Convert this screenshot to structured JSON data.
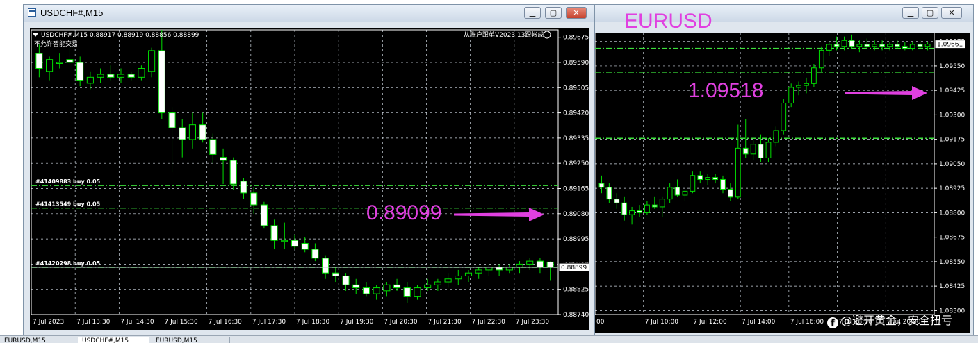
{
  "colors": {
    "bg": "#000000",
    "grid": "#cfd8e2",
    "bull": "#ffffff",
    "bear": "#ffffff",
    "wick": "#00e000",
    "level": "#3be03b",
    "accent": "#e040e0"
  },
  "back_window": {
    "title": "EURUSD",
    "axis_prices": [
      "1.09675",
      "1.09550",
      "1.09425",
      "1.09300",
      "1.09175",
      "1.09050",
      "1.08925",
      "1.08800",
      "1.08675",
      "1.08550",
      "1.08425",
      "1.08300"
    ],
    "time_labels": [
      "00",
      "7 Jul 10:00",
      "7 Jul 12:00",
      "7 Jul 14:00",
      "7 Jul 16:00",
      "7 Jul 18:00",
      "7 Jul 20:00"
    ],
    "current_price": "1.09661",
    "annotation": "1.09518",
    "arrow_icon": "right-arrow-icon"
  },
  "front_window": {
    "title": "USDCHF#,M15",
    "header_line": "USDCHF#,M15  0.88917 0.88919 0.88856 0.88899",
    "no_trade_text": "不允许智能交易",
    "signal_text": "从账户跟单V2023.13跟帐成",
    "axis_prices": [
      "0.89675",
      "0.89590",
      "0.89505",
      "0.89420",
      "0.89335",
      "0.89250",
      "0.89165",
      "0.89080",
      "0.88995",
      "0.88910",
      "0.88825",
      "0.88740"
    ],
    "time_labels": [
      "7 Jul 2023",
      "7 Jul 13:30",
      "7 Jul 14:30",
      "7 Jul 15:30",
      "7 Jul 16:30",
      "7 Jul 17:30",
      "7 Jul 18:30",
      "7 Jul 19:30",
      "7 Jul 20:30",
      "7 Jul 21:30",
      "7 Jul 22:30",
      "7 Jul 23:30"
    ],
    "current_price": "0.88899",
    "orders": [
      {
        "label": "#41409883 buy 0.05",
        "price": 0.89175
      },
      {
        "label": "#41413549 buy 0.05",
        "price": 0.89099
      },
      {
        "label": "#41420298 buy 0.05",
        "price": 0.88899
      }
    ],
    "annotation": "0.89099",
    "arrow_icon": "right-arrow-icon"
  },
  "chart_data": [
    {
      "type": "candlestick",
      "title": "USDCHF#,M15",
      "ylim": [
        0.8874,
        0.897
      ],
      "candles": [
        [
          0.8962,
          0.8965,
          0.8954,
          0.8957
        ],
        [
          0.8956,
          0.8961,
          0.8953,
          0.896
        ],
        [
          0.8959,
          0.8962,
          0.8957,
          0.8959
        ],
        [
          0.896,
          0.8964,
          0.8958,
          0.8959
        ],
        [
          0.8959,
          0.8961,
          0.8951,
          0.8953
        ],
        [
          0.8952,
          0.8956,
          0.895,
          0.8954
        ],
        [
          0.8954,
          0.8957,
          0.8952,
          0.8955
        ],
        [
          0.8955,
          0.8958,
          0.8953,
          0.8954
        ],
        [
          0.8954,
          0.8957,
          0.8952,
          0.8955
        ],
        [
          0.8955,
          0.8956,
          0.8953,
          0.8954
        ],
        [
          0.8954,
          0.8958,
          0.8953,
          0.8957
        ],
        [
          0.8956,
          0.8964,
          0.8954,
          0.8963
        ],
        [
          0.8963,
          0.897,
          0.894,
          0.8942
        ],
        [
          0.8942,
          0.8944,
          0.8922,
          0.8937
        ],
        [
          0.8937,
          0.894,
          0.8927,
          0.8933
        ],
        [
          0.8933,
          0.8942,
          0.893,
          0.8938
        ],
        [
          0.8938,
          0.8942,
          0.8932,
          0.8933
        ],
        [
          0.8933,
          0.8935,
          0.8925,
          0.8928
        ],
        [
          0.8927,
          0.893,
          0.8918,
          0.8926
        ],
        [
          0.8926,
          0.8927,
          0.8916,
          0.8918
        ],
        [
          0.8919,
          0.892,
          0.8913,
          0.8915
        ],
        [
          0.8915,
          0.8917,
          0.8908,
          0.8911
        ],
        [
          0.8911,
          0.8912,
          0.8903,
          0.8904
        ],
        [
          0.8904,
          0.8906,
          0.8896,
          0.8899
        ],
        [
          0.8899,
          0.8905,
          0.8896,
          0.8899
        ],
        [
          0.8899,
          0.8901,
          0.8896,
          0.8897
        ],
        [
          0.8898,
          0.89,
          0.8895,
          0.8896
        ],
        [
          0.8896,
          0.8898,
          0.8892,
          0.8893
        ],
        [
          0.8893,
          0.8894,
          0.8886,
          0.8888
        ],
        [
          0.8888,
          0.889,
          0.8885,
          0.8887
        ],
        [
          0.8887,
          0.8888,
          0.8882,
          0.8884
        ],
        [
          0.8884,
          0.8886,
          0.8881,
          0.8883
        ],
        [
          0.8883,
          0.8885,
          0.888,
          0.8881
        ],
        [
          0.8881,
          0.8884,
          0.8879,
          0.8883
        ],
        [
          0.8882,
          0.8885,
          0.888,
          0.8884
        ],
        [
          0.8884,
          0.8886,
          0.8882,
          0.8883
        ],
        [
          0.8883,
          0.8885,
          0.8878,
          0.888
        ],
        [
          0.888,
          0.8884,
          0.8879,
          0.8883
        ],
        [
          0.8883,
          0.8886,
          0.8882,
          0.8884
        ],
        [
          0.8884,
          0.8886,
          0.8882,
          0.8885
        ],
        [
          0.8885,
          0.8888,
          0.8883,
          0.8886
        ],
        [
          0.8886,
          0.8889,
          0.8884,
          0.8887
        ],
        [
          0.8887,
          0.8889,
          0.8885,
          0.8888
        ],
        [
          0.8888,
          0.889,
          0.8886,
          0.8889
        ],
        [
          0.8889,
          0.8891,
          0.8887,
          0.889
        ],
        [
          0.889,
          0.8891,
          0.8887,
          0.8889
        ],
        [
          0.8889,
          0.8891,
          0.8888,
          0.889
        ],
        [
          0.889,
          0.8892,
          0.8888,
          0.8891
        ],
        [
          0.8891,
          0.8893,
          0.8889,
          0.8892
        ],
        [
          0.8892,
          0.8893,
          0.8888,
          0.889
        ],
        [
          0.88917,
          0.88919,
          0.88856,
          0.88899
        ]
      ]
    },
    {
      "type": "candlestick",
      "title": "EURUSD",
      "ylim": [
        1.0828,
        1.0972
      ],
      "levels": [
        1.0964,
        1.09518,
        1.0918
      ],
      "candles": [
        [
          1.0895,
          1.0899,
          1.089,
          1.0893
        ],
        [
          1.0893,
          1.0895,
          1.0885,
          1.0887
        ],
        [
          1.0887,
          1.089,
          1.0882,
          1.0885
        ],
        [
          1.0885,
          1.0888,
          1.0876,
          1.0879
        ],
        [
          1.0879,
          1.0883,
          1.0874,
          1.0881
        ],
        [
          1.0881,
          1.0884,
          1.0878,
          1.088
        ],
        [
          1.088,
          1.0886,
          1.0879,
          1.0884
        ],
        [
          1.0884,
          1.0888,
          1.0882,
          1.0883
        ],
        [
          1.0883,
          1.0888,
          1.0878,
          1.0887
        ],
        [
          1.0887,
          1.0895,
          1.0885,
          1.0893
        ],
        [
          1.0893,
          1.0897,
          1.0888,
          1.0889
        ],
        [
          1.0889,
          1.0892,
          1.0886,
          1.0891
        ],
        [
          1.0891,
          1.0901,
          1.089,
          1.0899
        ],
        [
          1.0899,
          1.0901,
          1.0895,
          1.0897
        ],
        [
          1.0897,
          1.09,
          1.0894,
          1.0898
        ],
        [
          1.0898,
          1.09,
          1.0895,
          1.0897
        ],
        [
          1.0897,
          1.0899,
          1.089,
          1.0892
        ],
        [
          1.0892,
          1.0895,
          1.0886,
          1.0888
        ],
        [
          1.0888,
          1.0925,
          1.0887,
          1.0913
        ],
        [
          1.0913,
          1.0928,
          1.0908,
          1.091
        ],
        [
          1.091,
          1.0917,
          1.0907,
          1.0915
        ],
        [
          1.0915,
          1.092,
          1.0906,
          1.0908
        ],
        [
          1.0908,
          1.0918,
          1.0906,
          1.0916
        ],
        [
          1.0916,
          1.0924,
          1.0914,
          1.0922
        ],
        [
          1.0922,
          1.0938,
          1.092,
          1.0936
        ],
        [
          1.0936,
          1.0946,
          1.0934,
          1.0944
        ],
        [
          1.0944,
          1.0947,
          1.094,
          1.0945
        ],
        [
          1.0945,
          1.0949,
          1.0941,
          1.0946
        ],
        [
          1.0946,
          1.0956,
          1.0944,
          1.0954
        ],
        [
          1.0954,
          1.0965,
          1.0952,
          1.0963
        ],
        [
          1.0963,
          1.0967,
          1.096,
          1.0966
        ],
        [
          1.0966,
          1.097,
          1.0963,
          1.0965
        ],
        [
          1.0965,
          1.097,
          1.0963,
          1.0968
        ],
        [
          1.0968,
          1.0971,
          1.0964,
          1.0965
        ],
        [
          1.0965,
          1.0968,
          1.0962,
          1.0966
        ],
        [
          1.0966,
          1.0969,
          1.0964,
          1.0965
        ],
        [
          1.0965,
          1.0968,
          1.0963,
          1.0966
        ],
        [
          1.0966,
          1.0968,
          1.0963,
          1.0965
        ],
        [
          1.0965,
          1.0967,
          1.0963,
          1.0966
        ],
        [
          1.0966,
          1.0968,
          1.0964,
          1.0965
        ],
        [
          1.0965,
          1.0967,
          1.0963,
          1.0964
        ],
        [
          1.0964,
          1.0967,
          1.0963,
          1.0966
        ],
        [
          1.0966,
          1.0968,
          1.0964,
          1.0965
        ],
        [
          1.0965,
          1.0967,
          1.0963,
          1.09661
        ]
      ]
    }
  ],
  "tabs": [
    {
      "label": "EURUSD,M15"
    },
    {
      "label": "USDCHF#,M15"
    },
    {
      "label": "EURUSD,M15"
    }
  ],
  "watermark": {
    "icon": "f",
    "text": "@避开黄金，安全扭亏"
  }
}
